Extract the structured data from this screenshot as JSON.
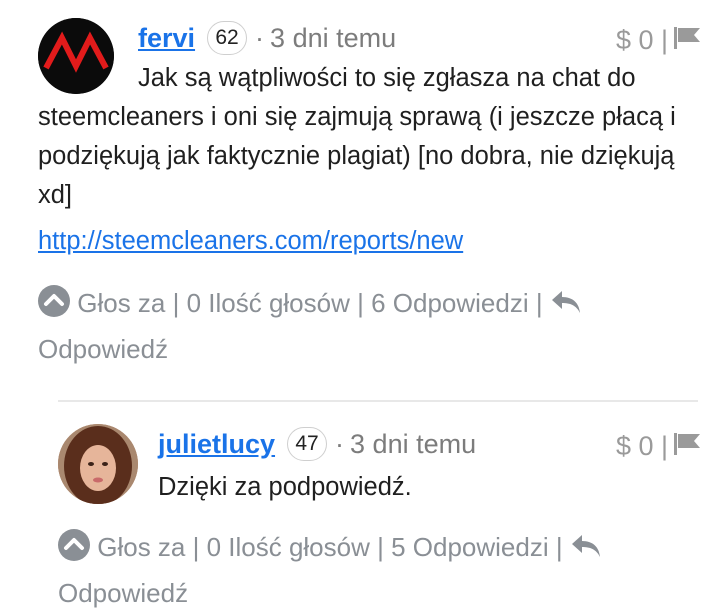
{
  "comment1": {
    "author": "fervi",
    "reputation": "62",
    "time": "3 dni temu",
    "payout": "$ 0 |",
    "body": "Jak są wątpliwości to się zgłasza na chat do steemcleaners i oni się zajmują sprawą (i jeszcze płacą i podziękują jak faktycznie plagiat) [no dobra, nie dziękują xd]",
    "link": "http://steemcleaners.com/reports/new",
    "actions": {
      "votes": "Głos za | 0 Ilość głosów | 6 Odpowiedzi |",
      "reply": "Odpowiedź"
    }
  },
  "comment2": {
    "author": "julietlucy",
    "reputation": "47",
    "time": "3 dni temu",
    "payout": "$ 0 |",
    "body": "Dzięki za podpowiedź.",
    "actions": {
      "votes": "Głos za | 0 Ilość głosów | 5 Odpowiedzi |",
      "reply": "Odpowiedź"
    }
  },
  "colors": {
    "link": "#1a73e8",
    "muted": "#8a8f95",
    "divider": "#e8e8e8"
  },
  "icons": [
    "avatar-logo",
    "upvote-chevron-icon",
    "reply-arrow-icon",
    "flag-icon"
  ]
}
